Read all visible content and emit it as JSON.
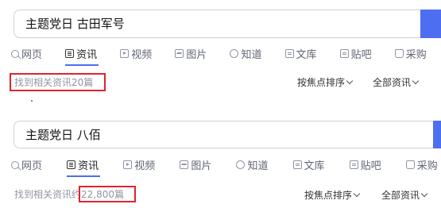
{
  "panel1": {
    "query": "主题党日 古田军号",
    "tabs": [
      {
        "label": "网页",
        "icon": "search-icon"
      },
      {
        "label": "资讯",
        "icon": "news-icon",
        "active": true
      },
      {
        "label": "视频",
        "icon": "video-icon"
      },
      {
        "label": "图片",
        "icon": "image-icon"
      },
      {
        "label": "知道",
        "icon": "question-icon"
      },
      {
        "label": "文库",
        "icon": "document-icon"
      },
      {
        "label": "贴吧",
        "icon": "tieba-icon"
      },
      {
        "label": "采购",
        "icon": "shopping-icon"
      }
    ],
    "count_text": "找到相关资讯20篇",
    "sort_label": "按焦点排序",
    "filter_label": "全部资讯"
  },
  "panel2": {
    "query": "主题党日 八佰",
    "tabs": [
      {
        "label": "网页",
        "icon": "search-icon"
      },
      {
        "label": "资讯",
        "icon": "news-icon",
        "active": true
      },
      {
        "label": "视频",
        "icon": "video-icon"
      },
      {
        "label": "图片",
        "icon": "image-icon"
      },
      {
        "label": "知道",
        "icon": "question-icon"
      },
      {
        "label": "文库",
        "icon": "document-icon"
      },
      {
        "label": "贴吧",
        "icon": "tieba-icon"
      },
      {
        "label": "采购",
        "icon": "shopping-icon"
      }
    ],
    "count_prefix": "找到相关资讯约",
    "count_value": "22,800篇",
    "sort_label": "按焦点排序",
    "filter_label": "全部资讯"
  },
  "colors": {
    "accent": "#4e6ef2",
    "highlight_box": "#e0242c",
    "muted_text": "#9195a3"
  }
}
